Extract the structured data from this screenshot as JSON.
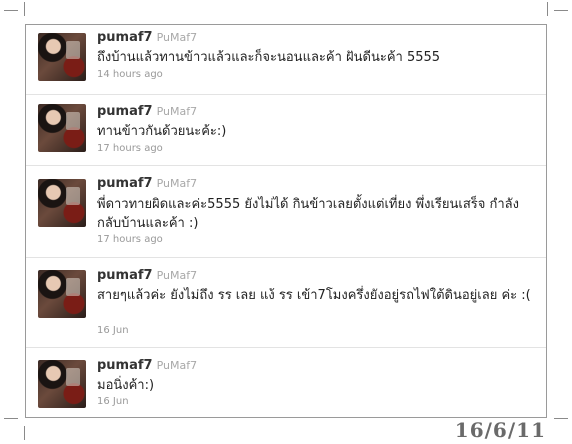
{
  "tweets": [
    {
      "handle": "pumaf7",
      "realname": "PuMaf7",
      "text": "ถึงบ้านแล้วทานข้าวแล้วและก็จะนอนและค้า ฝันดีนะค้า 5555",
      "time": "14 hours ago"
    },
    {
      "handle": "pumaf7",
      "realname": "PuMaf7",
      "text": "ทานข้าวกันด้วยนะค้ะ:)",
      "time": "17 hours ago"
    },
    {
      "handle": "pumaf7",
      "realname": "PuMaf7",
      "text": "พี่ดาวทายผิดและค่ะ5555 ยังไม่ได้ กินข้าวเลยตั้งแต่เที่ยง พึ่งเรียนเสร็จ กำลังกลับบ้านและค้า :)",
      "time": "17 hours ago"
    },
    {
      "handle": "pumaf7",
      "realname": "PuMaf7",
      "text": "สายๆแล้วค่ะ ยังไม่ถึง รร เลย แง้ รร เข้า7โมงครึ่งยังอยู่รถไฟใต้ดินอยู่เลย ค่ะ :(",
      "time": "16 Jun"
    },
    {
      "handle": "pumaf7",
      "realname": "PuMaf7",
      "text": "มอนิ่งค้า:)",
      "time": "16 Jun"
    }
  ],
  "datestamp": "16/6/11"
}
